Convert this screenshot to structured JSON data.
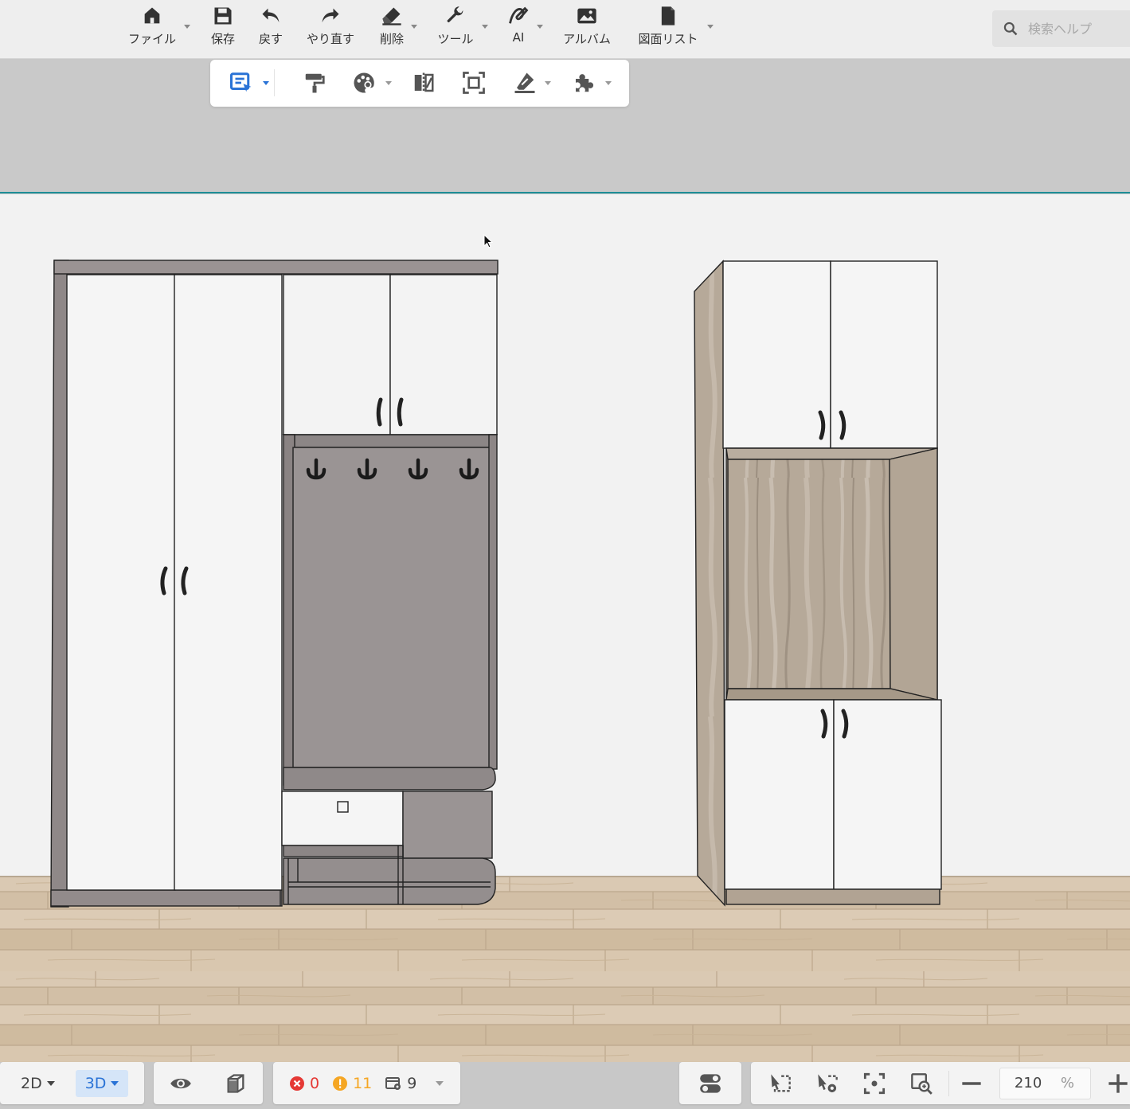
{
  "toolbar": {
    "items": [
      {
        "label": "ファイル",
        "icon": "home-icon"
      },
      {
        "label": "保存",
        "icon": "save-icon"
      },
      {
        "label": "戻す",
        "icon": "undo-icon"
      },
      {
        "label": "やり直す",
        "icon": "redo-icon"
      },
      {
        "label": "削除",
        "icon": "eraser-icon"
      },
      {
        "label": "ツール",
        "icon": "wrench-icon"
      },
      {
        "label": "AI",
        "icon": "ai-icon"
      },
      {
        "label": "アルバム",
        "icon": "album-icon"
      },
      {
        "label": "図面リスト",
        "icon": "document-icon"
      }
    ],
    "search_placeholder": "検索ヘルプ"
  },
  "subtoolbar": {
    "tools": [
      "select-tool-icon",
      "paint-roller-icon",
      "material-palette-icon",
      "mirror-icon",
      "group-select-icon",
      "level-icon",
      "plugin-icon"
    ],
    "accent": "#2a73d6"
  },
  "bottombar": {
    "view_2d": "2D",
    "view_3d": "3D",
    "active_view": "3D",
    "errors": "0",
    "warnings": "11",
    "components": "9",
    "zoom_value": "210",
    "zoom_unit": "%",
    "colors": {
      "error": "#e53935",
      "warning": "#f5a623"
    }
  },
  "colors": {
    "wall_upper": "#c9c9c9",
    "wall_line": "#1e8d96",
    "wall": "#f2f2f2",
    "door": "#f4f4f4",
    "carcass_gray": "#9a9494",
    "wood": "#b3a697",
    "floor": "#d9c8b2"
  }
}
